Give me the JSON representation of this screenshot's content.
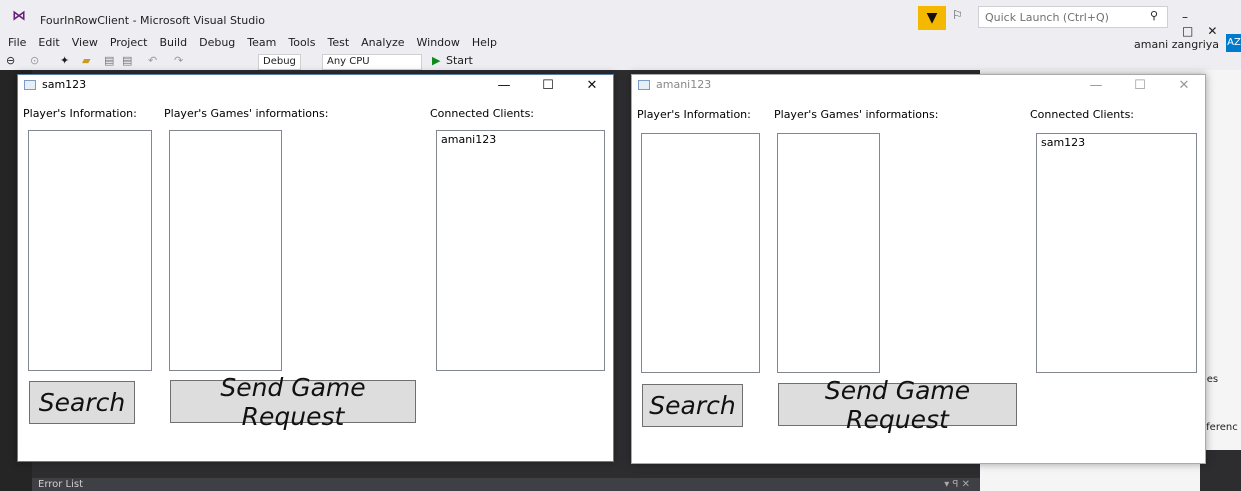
{
  "vs": {
    "title": "FourInRowClient - Microsoft Visual Studio",
    "quick_launch_placeholder": "Quick Launch (Ctrl+Q)",
    "menu": [
      "File",
      "Edit",
      "View",
      "Project",
      "Build",
      "Debug",
      "Team",
      "Tools",
      "Test",
      "Analyze",
      "Window",
      "Help"
    ],
    "user": "amani zangriya",
    "user_badge": "AZ",
    "config": "Debug",
    "platform": "Any CPU",
    "start_label": "Start",
    "error_list": "Error List",
    "right_panel_texts": [
      "ties",
      "eferenc"
    ]
  },
  "window1": {
    "title": "sam123",
    "label_player_info": "Player's Information:",
    "label_games_info": "Player's Games' informations:",
    "label_connected": "Connected Clients:",
    "connected_clients": [
      "amani123"
    ],
    "search_button": "Search",
    "send_button": "Send Game Request"
  },
  "window2": {
    "title": "amani123",
    "label_player_info": "Player's Information:",
    "label_games_info": "Player's Games' informations:",
    "label_connected": "Connected Clients:",
    "connected_clients": [
      "sam123"
    ],
    "search_button": "Search",
    "send_button": "Send Game Request"
  },
  "colors": {
    "vs_accent": "#007acc",
    "filter_icon_bg": "#f5b800",
    "window_border": "#5c7fa6"
  }
}
